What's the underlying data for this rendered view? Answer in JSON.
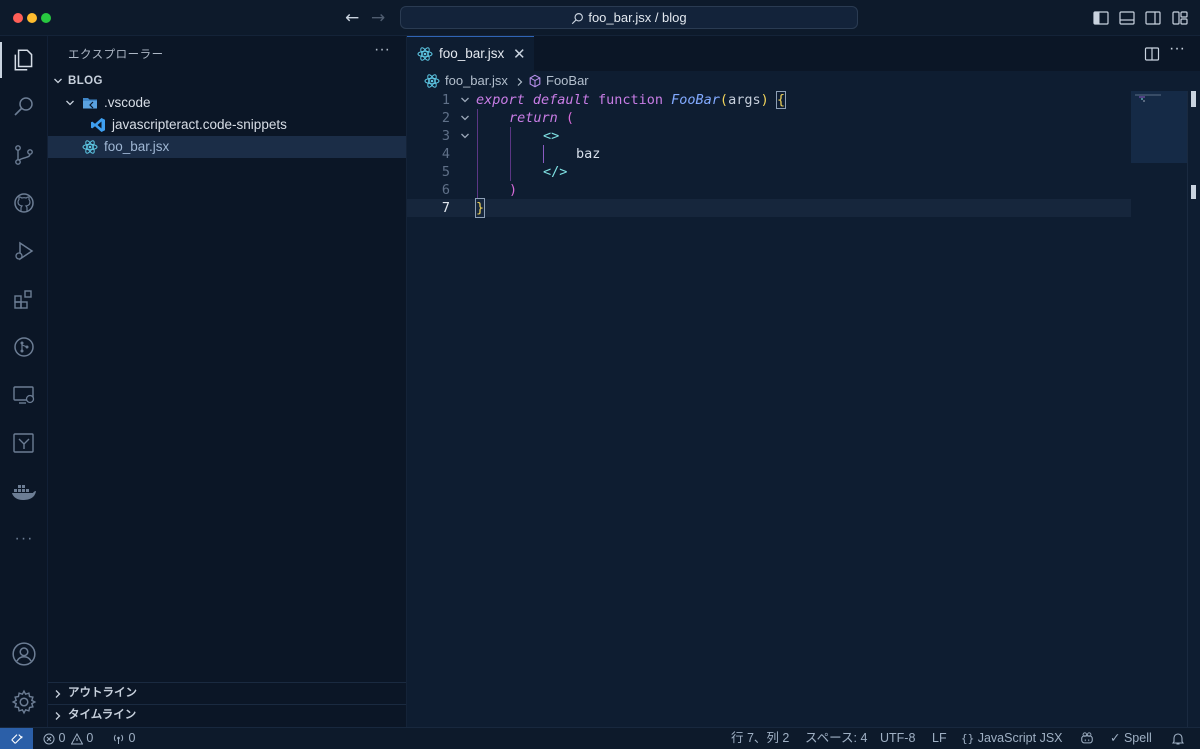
{
  "window": {
    "command_center": "foo_bar.jsx / blog"
  },
  "sidebar": {
    "title": "エクスプローラー",
    "root_label": "BLOG",
    "tree": [
      {
        "label": ".vscode",
        "type": "folder"
      },
      {
        "label": "javascripteract.code-snippets",
        "type": "file"
      },
      {
        "label": "foo_bar.jsx",
        "type": "file",
        "selected": true
      }
    ],
    "outline_label": "アウトライン",
    "timeline_label": "タイムライン"
  },
  "editor": {
    "tab_label": "foo_bar.jsx",
    "breadcrumb_file": "foo_bar.jsx",
    "breadcrumb_symbol": "FooBar",
    "lines": [
      {
        "num": "1",
        "tokens": [
          "export",
          " ",
          "default",
          " ",
          "function",
          " ",
          "FooBar",
          "(",
          "args",
          ")",
          " ",
          "{"
        ]
      },
      {
        "num": "2",
        "tokens": [
          "return",
          " ",
          "("
        ]
      },
      {
        "num": "3",
        "tokens": [
          "<>"
        ]
      },
      {
        "num": "4",
        "tokens": [
          "baz"
        ]
      },
      {
        "num": "5",
        "tokens": [
          "</>"
        ]
      },
      {
        "num": "6",
        "tokens": [
          ")"
        ]
      },
      {
        "num": "7",
        "tokens": [
          "}"
        ]
      }
    ],
    "current_line": "7"
  },
  "statusbar": {
    "errors": "0",
    "warnings": "0",
    "ports": "0",
    "position": "行 7、列 2",
    "indent": "スペース: 4",
    "encoding": "UTF-8",
    "eol": "LF",
    "language": "JavaScript JSX",
    "spell": "Spell"
  },
  "colors": {
    "accent": "#2b5fa8",
    "keyword": "#c97de6",
    "function_name": "#82aaff",
    "jsx_tag": "#7fe1e3",
    "bracket_yellow": "#f0d35b",
    "bracket_pink": "#d76ad9",
    "react_icon": "#5ec8e5"
  }
}
